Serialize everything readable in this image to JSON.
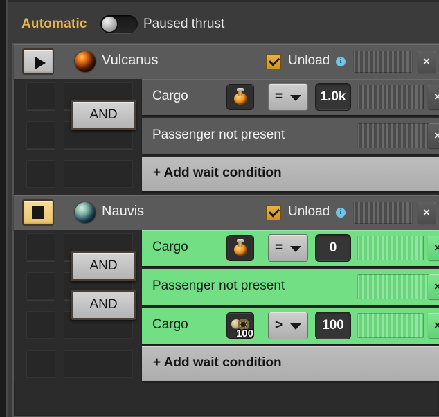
{
  "topbar": {
    "mode_label": "Automatic",
    "toggle_state": "off",
    "status_label": "Paused thrust"
  },
  "colors": {
    "accent_gold": "#e8b44b",
    "condition_met_green": "#72df85",
    "panel_bg": "#2b2b2b",
    "row_bg": "#5a5a5a",
    "info_blue": "#6fc4e8"
  },
  "sections": [
    {
      "station": "Vulcanus",
      "planet_icon": "vulcanus-planet-icon",
      "state_button": "play-icon",
      "state": "play",
      "interrupt_label": "Unload",
      "interrupt_checked": true,
      "info_char": "i",
      "close_char": "×",
      "conditions": [
        {
          "label": "Cargo",
          "met": false,
          "has_item": true,
          "item_icon": "flask-icon",
          "item_count": "",
          "operator": "=",
          "value": "1.0k",
          "and_label": "AND",
          "show_and": true
        },
        {
          "label": "Passenger not present",
          "met": false,
          "has_item": false,
          "item_icon": "",
          "item_count": "",
          "operator": "",
          "value": "",
          "and_label": "AND",
          "show_and": false
        }
      ],
      "add_label": "+ Add wait condition"
    },
    {
      "station": "Nauvis",
      "planet_icon": "nauvis-planet-icon",
      "state_button": "stop-icon",
      "state": "stop",
      "interrupt_label": "Unload",
      "interrupt_checked": true,
      "info_char": "i",
      "close_char": "×",
      "conditions": [
        {
          "label": "Cargo",
          "met": true,
          "has_item": true,
          "item_icon": "flask-icon",
          "item_count": "",
          "operator": "=",
          "value": "0",
          "and_label": "AND",
          "show_and": true
        },
        {
          "label": "Passenger not present",
          "met": true,
          "has_item": false,
          "item_icon": "",
          "item_count": "",
          "operator": "",
          "value": "",
          "and_label": "AND",
          "show_and": true
        },
        {
          "label": "Cargo",
          "met": true,
          "has_item": true,
          "item_icon": "gear-icon",
          "item_count": "100",
          "operator": ">",
          "value": "100",
          "and_label": "AND",
          "show_and": false
        }
      ],
      "add_label": "+ Add wait condition"
    }
  ]
}
